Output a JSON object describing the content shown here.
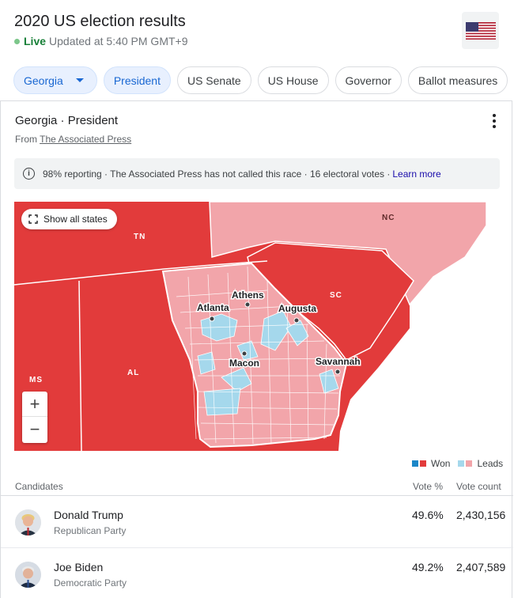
{
  "header": {
    "title": "2020 US election results",
    "live_label": "Live",
    "updated_text": "Updated at 5:40 PM GMT+9"
  },
  "chips": [
    {
      "label": "Georgia",
      "selected": true,
      "dropdown": true
    },
    {
      "label": "President",
      "selected": true
    },
    {
      "label": "US Senate"
    },
    {
      "label": "US House"
    },
    {
      "label": "Governor"
    },
    {
      "label": "Ballot measures"
    }
  ],
  "race": {
    "title": "Georgia · President",
    "source_prefix": "From",
    "source_name": "The Associated Press",
    "info_text": "98% reporting · The Associated Press has not called this race · 16 electoral votes ·",
    "learn_more": "Learn more"
  },
  "map": {
    "show_all_states": "Show all states",
    "zoom_in": "+",
    "zoom_out": "−",
    "state_labels": {
      "tn": "TN",
      "nc": "NC",
      "sc": "SC",
      "ms": "MS",
      "al": "AL"
    },
    "city_labels": {
      "atlanta": "Atlanta",
      "athens": "Athens",
      "augusta": "Augusta",
      "macon": "Macon",
      "savannah": "Savannah"
    },
    "colors": {
      "rep_won": "#e23b3b",
      "rep_leads": "#f2a5aa",
      "dem_won": "#1a86c8",
      "dem_leads": "#a5d8ec"
    }
  },
  "legend": {
    "won": "Won",
    "leads": "Leads"
  },
  "table": {
    "col_candidates": "Candidates",
    "col_vote_pct": "Vote %",
    "col_vote_count": "Vote count",
    "rows": [
      {
        "name": "Donald Trump",
        "party": "Republican Party",
        "pct": "49.6%",
        "votes": "2,430,156"
      },
      {
        "name": "Joe Biden",
        "party": "Democratic Party",
        "pct": "49.2%",
        "votes": "2,407,589"
      }
    ]
  }
}
